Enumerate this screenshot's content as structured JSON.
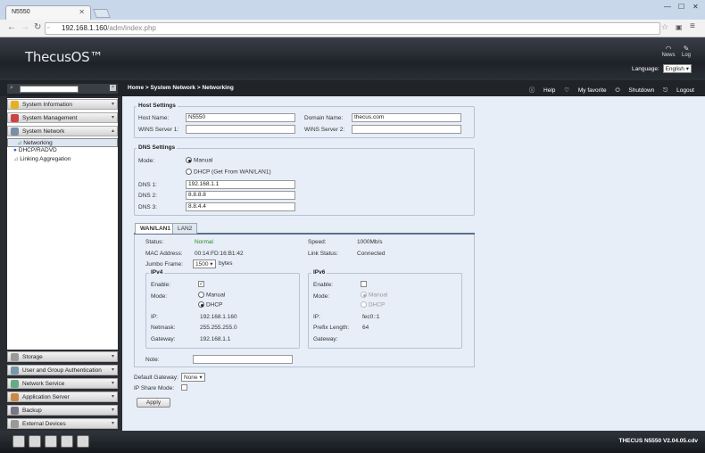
{
  "browser": {
    "tab_title": "N5550",
    "tab_close": "✕",
    "url_host": "192.168.1.160",
    "url_path": "/adm/index.php",
    "win_min": "—",
    "win_max": "☐",
    "win_close": "✕"
  },
  "header": {
    "logo": "ThecusOS™",
    "news": "News",
    "log": "Log",
    "language_label": "Language:",
    "language_value": "English"
  },
  "topbar": {
    "breadcrumb": "Home > System Network > Networking",
    "help": "Help",
    "my_favorite": "My favorite",
    "shutdown": "Shutdown",
    "logout": "Logout"
  },
  "sidebar": {
    "top_menus": [
      "System Information",
      "System Management",
      "System Network"
    ],
    "sub_items": [
      "Networking",
      "DHCP/RADVD",
      "Linking Aggregation"
    ],
    "bottom_menus": [
      "Storage",
      "User and Group Authentication",
      "Network Service",
      "Application Server",
      "Backup",
      "External Devices"
    ]
  },
  "host": {
    "legend": "Host Settings",
    "host_name_label": "Host Name:",
    "host_name": "N5550",
    "domain_label": "Domain Name:",
    "domain": "thecus.com",
    "wins1_label": "WINS Server 1:",
    "wins1": "",
    "wins2_label": "WINS Server 2:",
    "wins2": ""
  },
  "dns": {
    "legend": "DNS Settings",
    "mode_label": "Mode:",
    "manual": "Manual",
    "dhcp": "DHCP (Get From WAN/LAN1)",
    "dns1_label": "DNS 1:",
    "dns1": "192.168.1.1",
    "dns2_label": "DNS 2:",
    "dns2": "8.8.8.8",
    "dns3_label": "DNS 3:",
    "dns3": "8.8.4.4"
  },
  "wan": {
    "tab1": "WAN/LAN1",
    "tab2": "LAN2",
    "status_label": "Status:",
    "status": "Normal",
    "speed_label": "Speed:",
    "speed": "1000Mb/s",
    "mac_label": "MAC Address:",
    "mac": "00:14:FD:16:B1:42",
    "link_label": "Link Status:",
    "link": "Connected",
    "jumbo_label": "Jumbo Frame:",
    "jumbo": "1500",
    "bytes": "bytes",
    "note_label": "Note:"
  },
  "ipv4": {
    "legend": "IPv4",
    "enable_label": "Enable:",
    "mode_label": "Mode:",
    "manual": "Manual",
    "dhcp": "DHCP",
    "ip_label": "IP:",
    "ip": "192.168.1.160",
    "netmask_label": "Netmask:",
    "netmask": "255.255.255.0",
    "gateway_label": "Gateway:",
    "gateway": "192.168.1.1"
  },
  "ipv6": {
    "legend": "IPv6",
    "enable_label": "Enable:",
    "mode_label": "Mode:",
    "manual": "Manual",
    "dhcp": "DHCP",
    "ip_label": "IP:",
    "ip": "fec0::1",
    "prefix_label": "Prefix Length:",
    "prefix": "64",
    "gateway_label": "Gateway:"
  },
  "footer_form": {
    "default_gw_label": "Default Gateway:",
    "default_gw": "None",
    "ip_share_label": "IP Share Mode:",
    "apply": "Apply"
  },
  "bottom": {
    "version": "THECUS N5550 V2.04.05.cdv"
  }
}
